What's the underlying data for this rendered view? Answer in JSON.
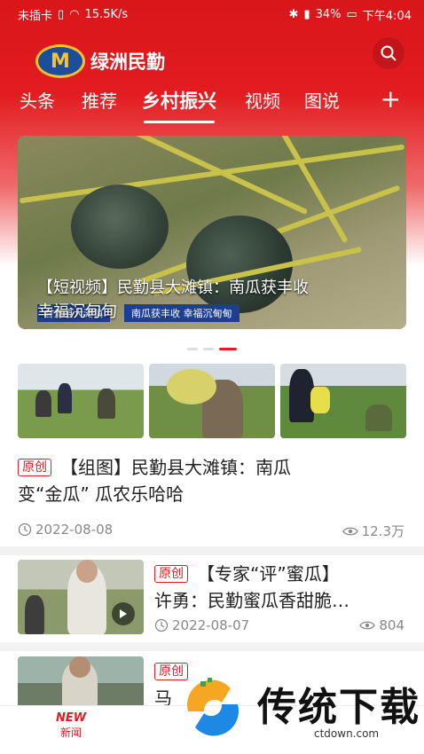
{
  "status": {
    "carrier": "未插卡",
    "speed": "15.5K/s",
    "battery": "34%",
    "time": "下午4:04"
  },
  "app": {
    "logo_text": "绿洲民勤",
    "logo_mark": "M"
  },
  "tabs": [
    {
      "label": "头条"
    },
    {
      "label": "推荐"
    },
    {
      "label": "乡村振兴",
      "active": true
    },
    {
      "label": "视频"
    },
    {
      "label": "图说"
    }
  ],
  "plus_label": "+",
  "banner": {
    "title_line1": "【短视频】民勤县大滩镇：南瓜获丰收",
    "title_line2": "幸福沉甸甸",
    "subtitle_left": "甘肃县大滩镇",
    "subtitle_right": "南瓜获丰收 幸福沉甸甸",
    "active_dot": 2
  },
  "articles": [
    {
      "badge": "原创",
      "title": "【组图】民勤县大滩镇：南瓜变“金瓜” 瓜农乐哈哈",
      "title_line1": "【组图】民勤县大滩镇：南瓜",
      "title_line2": "变“金瓜”  瓜农乐哈哈",
      "date": "2022-08-08",
      "views": "12.3万"
    },
    {
      "badge": "原创",
      "title_line1": "【专家“评”蜜瓜】",
      "title_line2": "许勇：民勤蜜瓜香甜脆…",
      "date": "2022-08-07",
      "views": "804"
    },
    {
      "badge": "原创",
      "title_line1": "马"
    }
  ],
  "bottom_nav": {
    "icon_text": "NEW",
    "label": "新闻"
  },
  "watermark": {
    "text": "传统下载",
    "url": "ctdown.com"
  },
  "colors": {
    "brand_red": "#e21c20",
    "logo_blue": "#1b4e9b",
    "logo_gold": "#f6c231"
  }
}
